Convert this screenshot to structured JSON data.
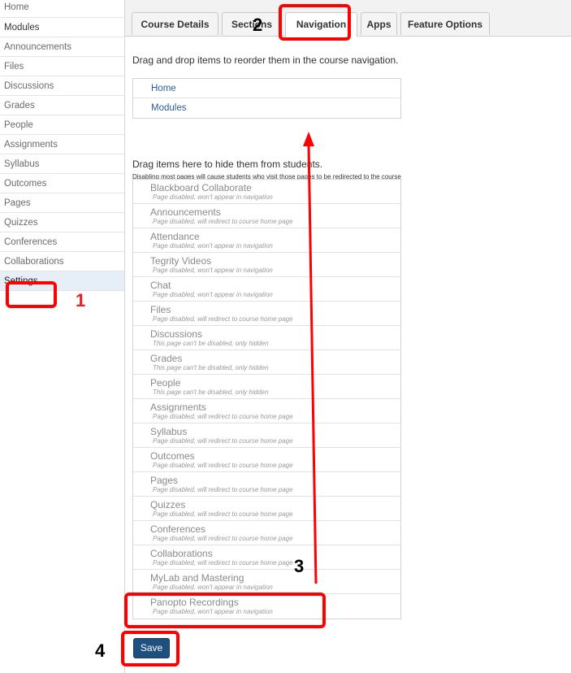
{
  "sidebar": {
    "items": [
      {
        "label": "Home",
        "style": "first"
      },
      {
        "label": "Modules",
        "style": "strong"
      },
      {
        "label": "Announcements"
      },
      {
        "label": "Files"
      },
      {
        "label": "Discussions"
      },
      {
        "label": "Grades"
      },
      {
        "label": "People"
      },
      {
        "label": "Assignments"
      },
      {
        "label": "Syllabus"
      },
      {
        "label": "Outcomes"
      },
      {
        "label": "Pages"
      },
      {
        "label": "Quizzes"
      },
      {
        "label": "Conferences"
      },
      {
        "label": "Collaborations"
      },
      {
        "label": "Settings",
        "style": "active"
      }
    ]
  },
  "tabs": [
    {
      "label": "Course Details"
    },
    {
      "label": "Sections"
    },
    {
      "label": "Navigation",
      "active": true
    },
    {
      "label": "Apps"
    },
    {
      "label": "Feature Options"
    }
  ],
  "navigation": {
    "intro": "Drag and drop items to reorder them in the course navigation.",
    "visible_items": [
      "Home",
      "Modules"
    ],
    "hide_title": "Drag items here to hide them from students.",
    "hide_note": "Disabling most pages will cause students who visit those pages to be redirected to the course home page.",
    "hidden_items": [
      {
        "name": "Blackboard Collaborate",
        "status": "Page disabled, won't appear in navigation"
      },
      {
        "name": "Announcements",
        "status": "Page disabled, will redirect to course home page"
      },
      {
        "name": "Attendance",
        "status": "Page disabled, won't appear in navigation"
      },
      {
        "name": "Tegrity Videos",
        "status": "Page disabled, won't appear in navigation"
      },
      {
        "name": "Chat",
        "status": "Page disabled, won't appear in navigation"
      },
      {
        "name": "Files",
        "status": "Page disabled, will redirect to course home page"
      },
      {
        "name": "Discussions",
        "status": "This page can't be disabled, only hidden"
      },
      {
        "name": "Grades",
        "status": "This page can't be disabled, only hidden"
      },
      {
        "name": "People",
        "status": "This page can't be disabled, only hidden"
      },
      {
        "name": "Assignments",
        "status": "Page disabled, will redirect to course home page"
      },
      {
        "name": "Syllabus",
        "status": "Page disabled, will redirect to course home page"
      },
      {
        "name": "Outcomes",
        "status": "Page disabled, will redirect to course home page"
      },
      {
        "name": "Pages",
        "status": "Page disabled, will redirect to course home page"
      },
      {
        "name": "Quizzes",
        "status": "Page disabled, will redirect to course home page"
      },
      {
        "name": "Conferences",
        "status": "Page disabled, will redirect to course home page"
      },
      {
        "name": "Collaborations",
        "status": "Page disabled, will redirect to course home page"
      },
      {
        "name": "MyLab and Mastering",
        "status": "Page disabled, won't appear in navigation"
      },
      {
        "name": "Panopto Recordings",
        "status": "Page disabled, won't appear in navigation"
      }
    ],
    "save_label": "Save"
  },
  "annotations": {
    "step1": "1",
    "step2": "2",
    "step3": "3",
    "step4": "4",
    "color": "#ff0000"
  },
  "colors": {
    "link": "#2a5d9f",
    "save_button": "#1f4f7f",
    "sidebar_active": "#e6eef7"
  }
}
